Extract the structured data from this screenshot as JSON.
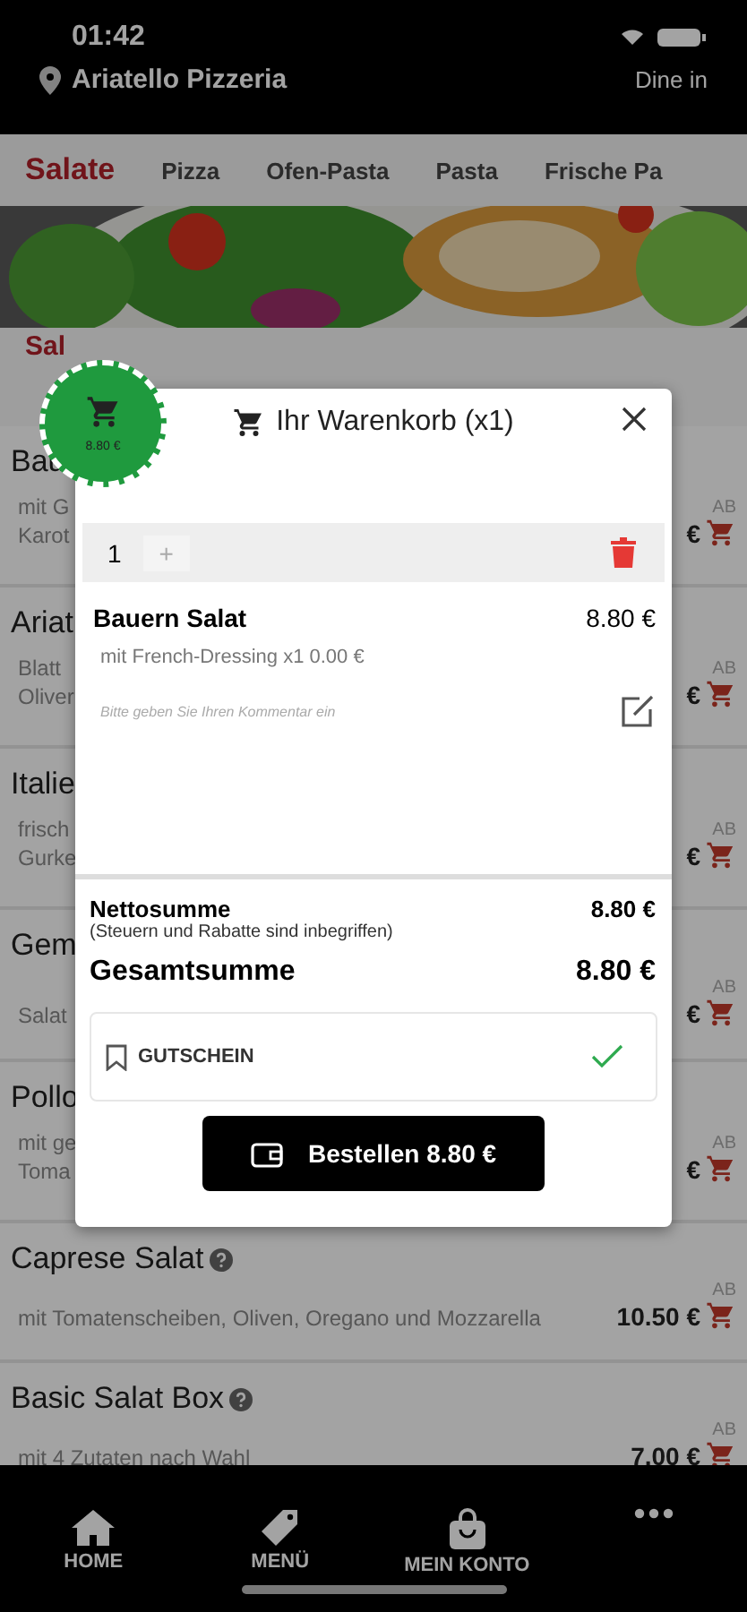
{
  "status_bar": {
    "time": "01:42"
  },
  "header": {
    "location": "Ariatello Pizzeria",
    "mode": "Dine in"
  },
  "categories": [
    {
      "label": "Salate",
      "selected": true
    },
    {
      "label": "Pizza",
      "selected": false
    },
    {
      "label": "Ofen-Pasta",
      "selected": false
    },
    {
      "label": "Pasta",
      "selected": false
    },
    {
      "label": "Frische Pa",
      "selected": false
    }
  ],
  "section_title": "Sal",
  "products": [
    {
      "name": "Bau",
      "description": [
        "mit G",
        "Karot"
      ],
      "prefix": "AB",
      "price": "€"
    },
    {
      "name": "Ariat",
      "description": [
        "Blatt",
        "Oliver"
      ],
      "prefix": "AB",
      "price": "€"
    },
    {
      "name": "Italie",
      "description": [
        "frisch",
        "Gurke"
      ],
      "prefix": "AB",
      "price": "€"
    },
    {
      "name": "Gem",
      "description": [
        "Salat"
      ],
      "prefix": "AB",
      "price": "€"
    },
    {
      "name": "Pollo",
      "description": [
        "mit ge",
        "Toma"
      ],
      "prefix": "AB",
      "price": "€"
    },
    {
      "name": "Caprese Salat",
      "help": true,
      "description": [
        "mit Tomatenscheiben, Oliven, Oregano und Mozzarella"
      ],
      "prefix": "AB",
      "price": "10.50 €"
    },
    {
      "name": "Basic Salat Box",
      "help": true,
      "description": [
        "mit 4 Zutaten nach Wahl"
      ],
      "prefix": "AB",
      "price": "7.00 €"
    }
  ],
  "cart_bubble": {
    "total": "8.80 €"
  },
  "cart": {
    "title": "Ihr Warenkorb (x1)",
    "quantity": "1",
    "plus": "+",
    "items": [
      {
        "name": "Bauern Salat",
        "price": "8.80 €",
        "options": [
          "mit French-Dressing x1 0.00 €"
        ]
      }
    ],
    "comment_placeholder": "Bitte geben Sie Ihren Kommentar ein",
    "net_label": "Nettosumme",
    "net_value": "8.80 €",
    "net_note": "(Steuern und Rabatte sind inbegriffen)",
    "total_label": "Gesamtsumme",
    "total_value": "8.80 €",
    "voucher": {
      "label": "GUTSCHEIN",
      "applied": true
    },
    "order_button": "Bestellen 8.80 €"
  },
  "nav": [
    {
      "kind": "home",
      "label": "HOME"
    },
    {
      "kind": "tag",
      "label": "MENÜ"
    },
    {
      "kind": "bag",
      "label": "MEIN KONTO"
    },
    {
      "kind": "more"
    }
  ]
}
